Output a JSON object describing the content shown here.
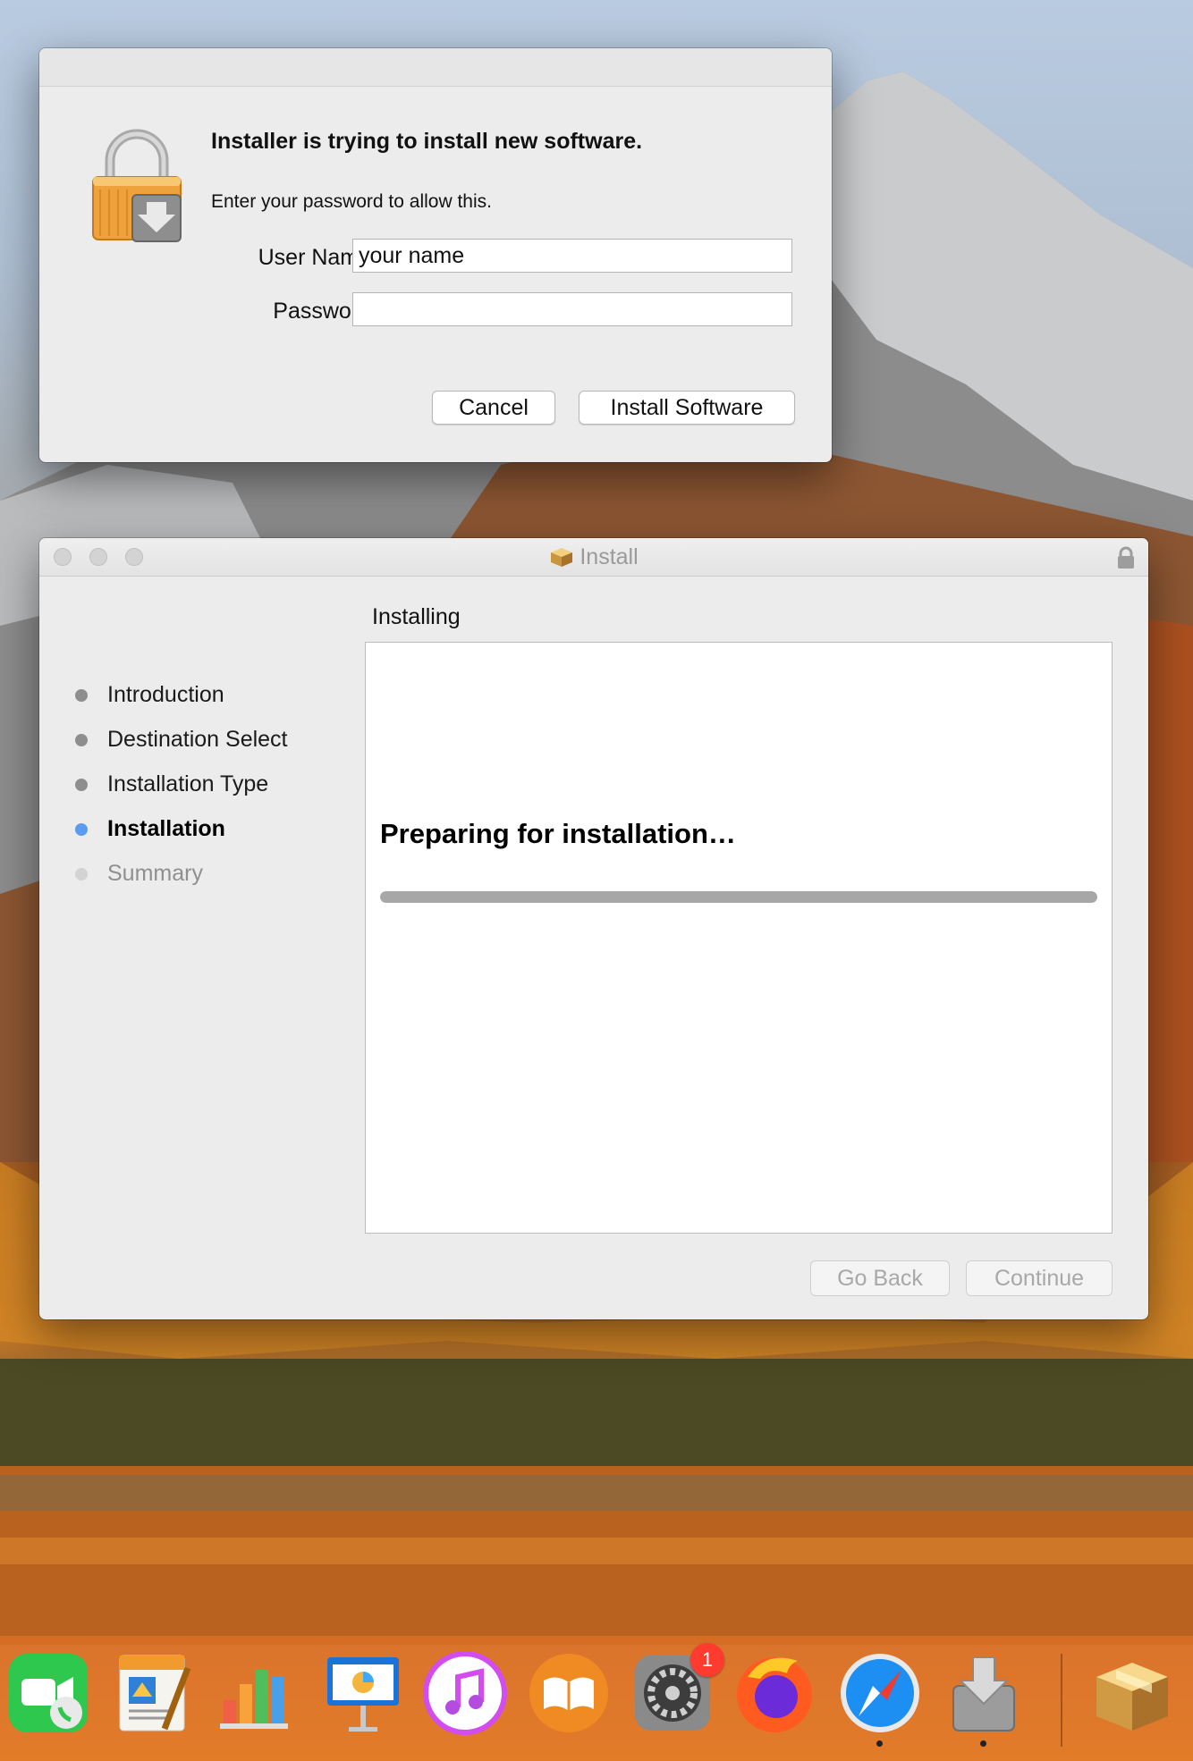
{
  "auth_dialog": {
    "title": "Installer is trying to install new software.",
    "subtitle": "Enter your password to allow this.",
    "username_label": "User Name:",
    "username_value": "your name",
    "password_label": "Password:",
    "password_value": "",
    "cancel_label": "Cancel",
    "install_label": "Install Software"
  },
  "installer": {
    "window_title": "Install",
    "section_title": "Installing",
    "steps": [
      {
        "label": "Introduction",
        "state": "done"
      },
      {
        "label": "Destination Select",
        "state": "done"
      },
      {
        "label": "Installation Type",
        "state": "done"
      },
      {
        "label": "Installation",
        "state": "current"
      },
      {
        "label": "Summary",
        "state": "pending"
      }
    ],
    "status_text": "Preparing for installation…",
    "progress": 1.0,
    "go_back_label": "Go Back",
    "continue_label": "Continue"
  },
  "dock": {
    "items": [
      "facetime-icon",
      "pages-icon",
      "numbers-icon",
      "keynote-icon",
      "itunes-icon",
      "ibooks-icon",
      "system-preferences-icon",
      "firefox-icon",
      "safari-icon",
      "installer-icon",
      "package-icon"
    ],
    "system_preferences_badge": "1",
    "running": [
      "safari-icon",
      "installer-icon"
    ]
  },
  "colors": {
    "accent": "#5b9cf0",
    "badge": "#ff3b30"
  }
}
